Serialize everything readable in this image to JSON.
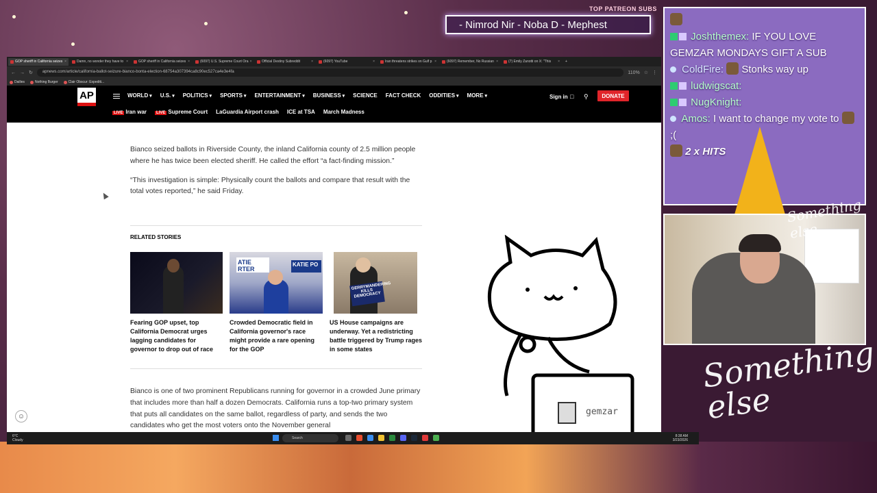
{
  "stream": {
    "patreon_label": "TOP PATREON SUBS",
    "patreon_names": "- Nimrod Nir - Noba D - Mephest",
    "brand": "Something else",
    "brand_small": "Something else"
  },
  "browser": {
    "tabs": [
      {
        "title": "GOP sheriff in California seizes",
        "active": true
      },
      {
        "title": "Damn, no wonder they have to"
      },
      {
        "title": "GOP sheriff in California seizes"
      },
      {
        "title": "(6097) U.S. Supreme Court Ora"
      },
      {
        "title": "Official Destiny Subreddit"
      },
      {
        "title": "(6097) YouTube"
      },
      {
        "title": "Iran threatens strikes on Gulf p"
      },
      {
        "title": "(6097) Remember, No Russian"
      },
      {
        "title": "(7) Emily Zanotti on X: \"This"
      }
    ],
    "url": "apnews.com/article/california-ballot-seizure-bianco-bonta-election-68754a307394ca8c90ec527ca4e3e4fa",
    "zoom": "110%",
    "bookmarks": [
      "Dailies",
      "Nothing Burger",
      "Clair Obscur: Expediti..."
    ]
  },
  "ap": {
    "logo": "AP",
    "nav": [
      "WORLD",
      "U.S.",
      "POLITICS",
      "SPORTS",
      "ENTERTAINMENT",
      "BUSINESS",
      "SCIENCE",
      "FACT CHECK",
      "ODDITIES",
      "MORE"
    ],
    "live_label": "LIVE",
    "subnav": [
      "Iran war",
      "Supreme Court",
      "LaGuardia Airport crash",
      "ICE at TSA",
      "March Madness"
    ],
    "signin": "Sign in",
    "donate": "DONATE"
  },
  "article": {
    "para1": "Bianco seized ballots in Riverside County, the inland California county of 2.5 million people where he has twice been elected sheriff. He called the effort “a fact-finding mission.”",
    "para2": "“This investigation is simple: Physically count the ballots and compare that result with the total votes reported,” he said Friday.",
    "related_title": "RELATED STORIES",
    "stories": [
      {
        "caption": "Fearing GOP upset, top California Democrat urges lagging candidates for governor to drop out of race"
      },
      {
        "caption": "Crowded Democratic field in California governor's race might provide a rare opening for the GOP"
      },
      {
        "caption": "US House campaigns are underway. Yet a redistricting battle triggered by Trump rages in some states"
      }
    ],
    "sign1": "ATIE RTER",
    "sign2": "KATIE PO",
    "sign3": "GERRYMANDERING KILLS DEMOCRACY",
    "para3": "Bianco is one of two prominent Republicans running for governor in a crowded June primary that includes more than half a dozen Democrats. California runs a top-two primary system that puts all candidates on the same ballot, regardless of party, and sends the two candidates who get the most voters onto the November general"
  },
  "cat_label": "gemzar",
  "taskbar": {
    "weather_temp": "6°C",
    "weather_desc": "Cloudy",
    "search": "Search",
    "time": "8:38 AM",
    "date": "3/23/2026"
  },
  "chat": {
    "messages": [
      {
        "user": "Joshthemex:",
        "text": "IF YOU LOVE GEMZAR MONDAYS GIFT A SUB"
      },
      {
        "user": "ColdFire:",
        "text": "Stonks way up"
      },
      {
        "user": "ludwigscat:",
        "text": ""
      },
      {
        "user": "NugKnight:",
        "text": ""
      },
      {
        "user": "Amos:",
        "text": "I want to change my vote to"
      },
      {
        "text": "2 x HITS"
      }
    ],
    "sad": ";("
  },
  "colors": {
    "ap_red": "#e0242a",
    "chat_bg": "#8b6bc0",
    "cone": "#f2b21a"
  }
}
